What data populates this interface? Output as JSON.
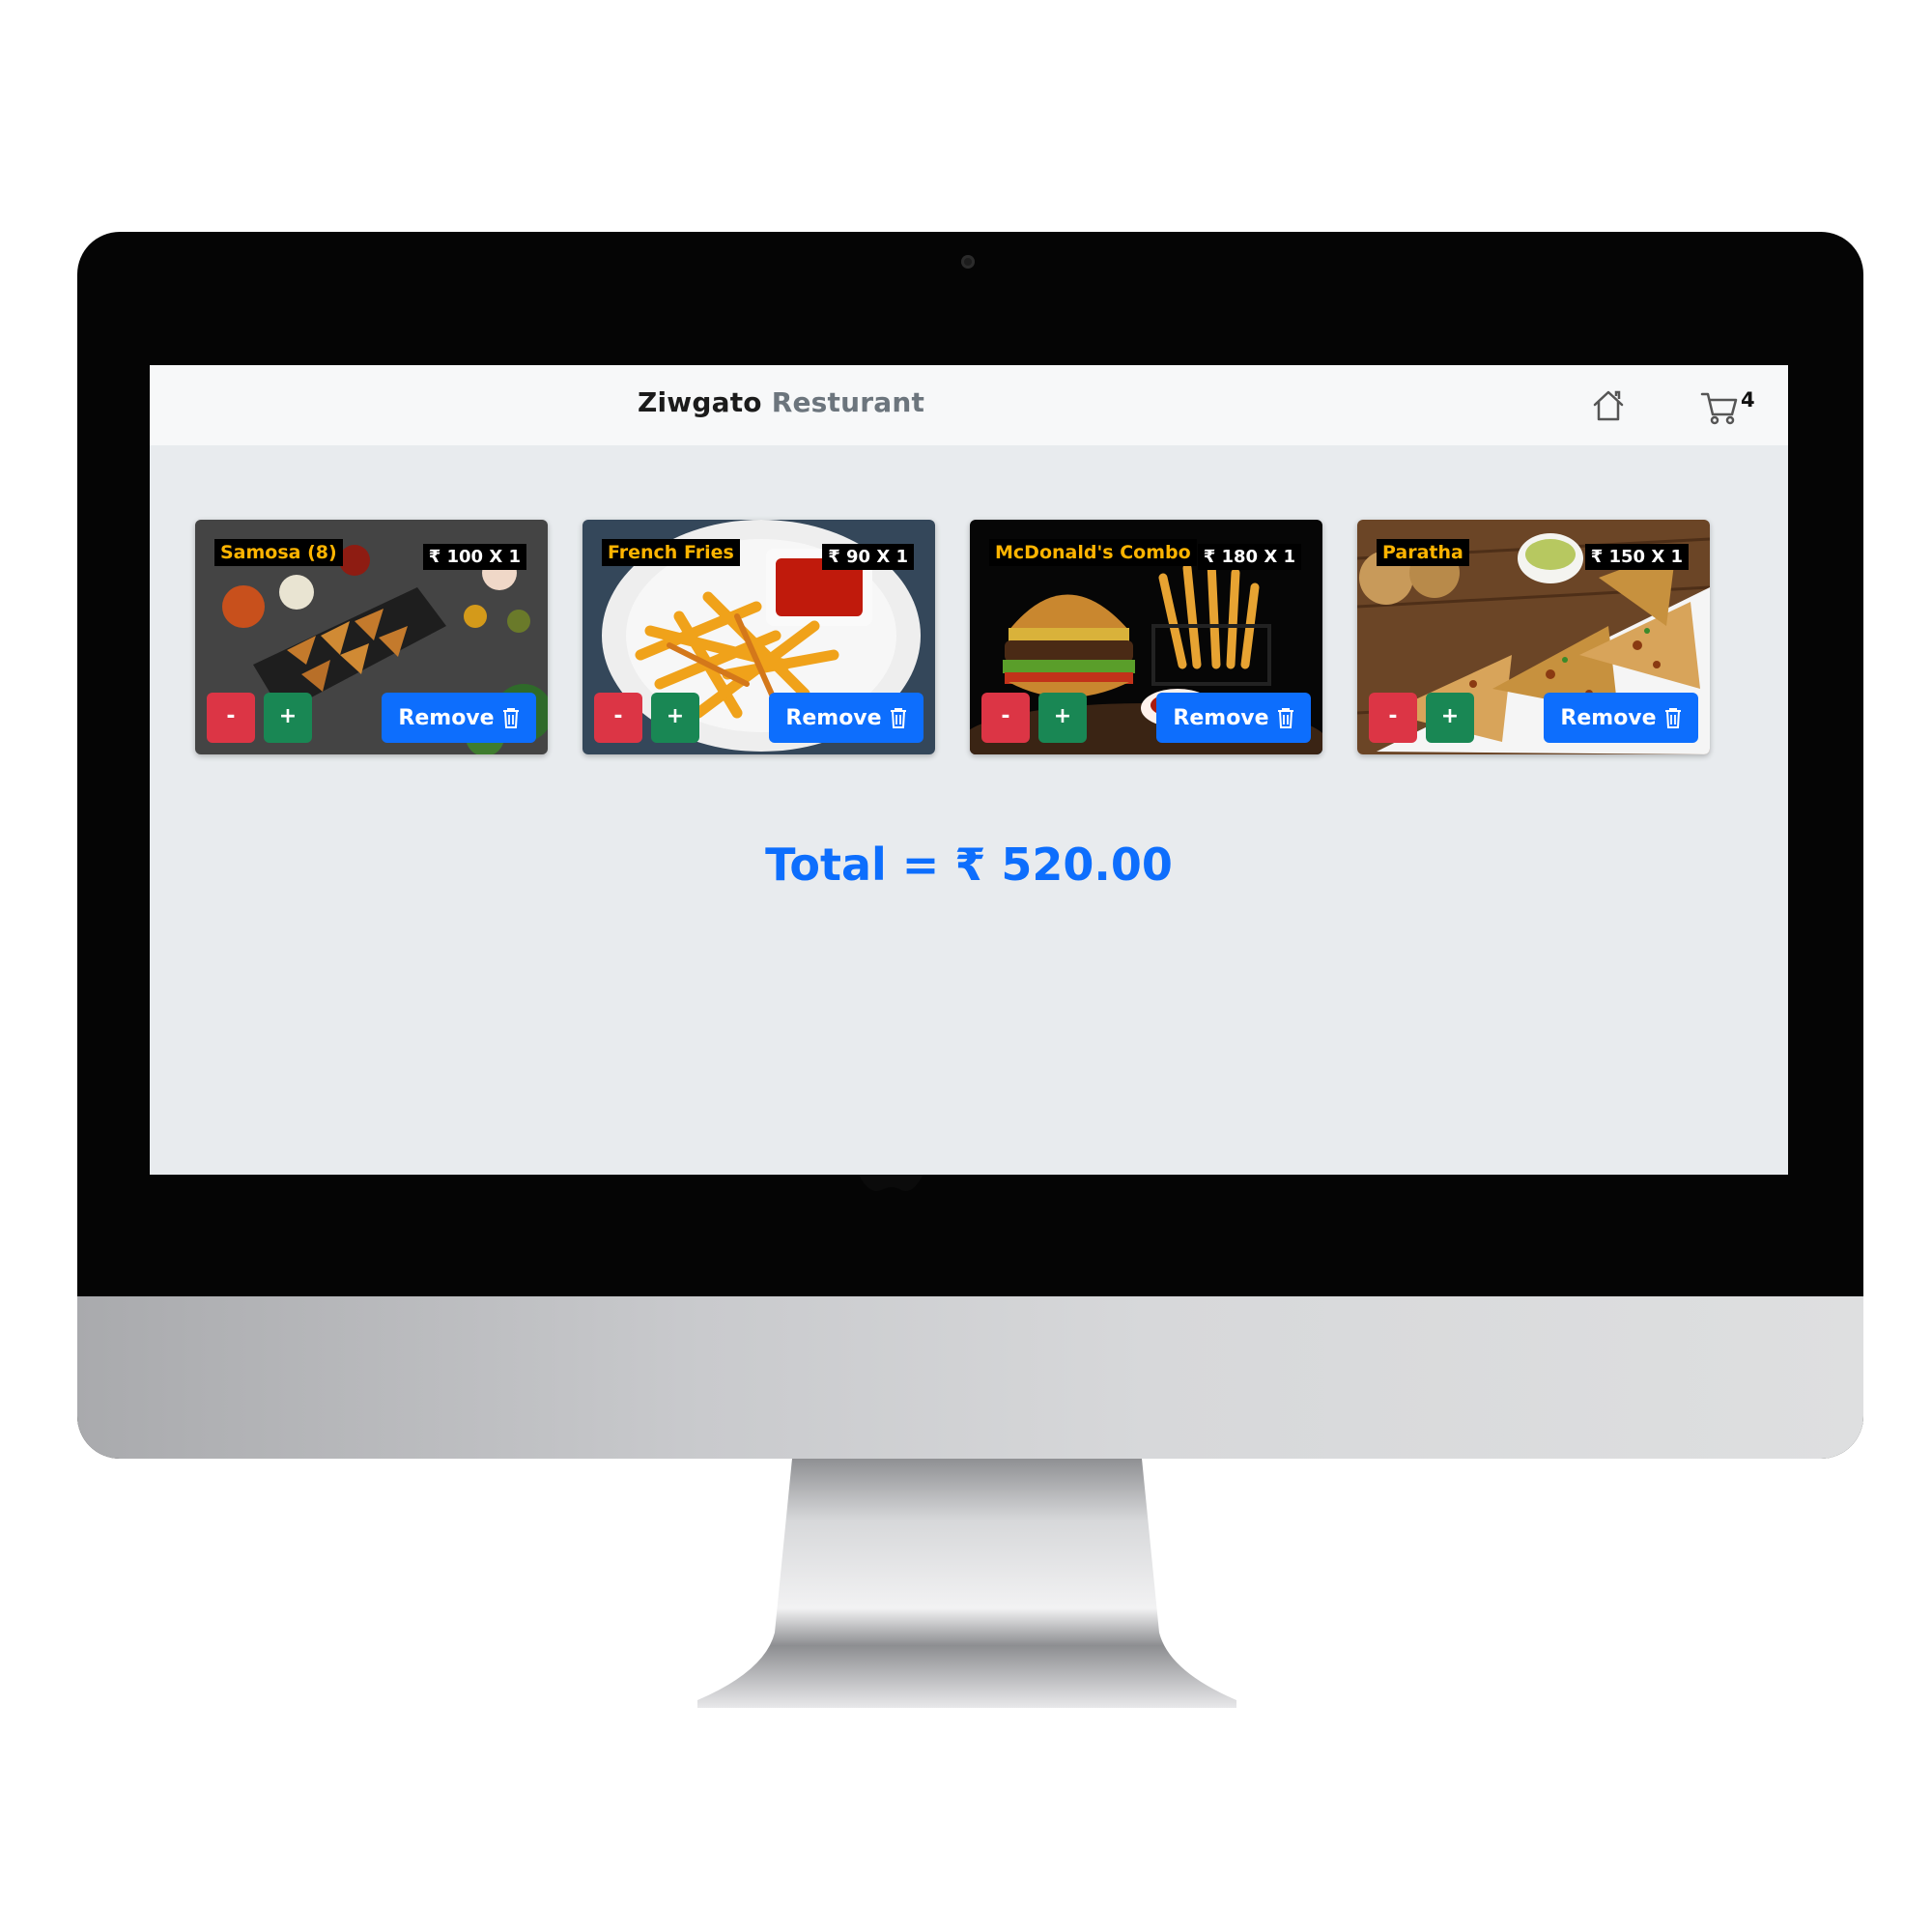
{
  "navbar": {
    "brand_main": "Ziwgato",
    "brand_sub": "Resturant",
    "cart_count": "4"
  },
  "cart": {
    "items": [
      {
        "name": "Samosa (8)",
        "price_label": "₹ 100 X 1",
        "minus": "-",
        "plus": "+",
        "remove": "Remove"
      },
      {
        "name": "French Fries",
        "price_label": "₹ 90 X 1",
        "minus": "-",
        "plus": "+",
        "remove": "Remove"
      },
      {
        "name": "McDonald's Combo",
        "price_label": "₹ 180 X 1",
        "minus": "-",
        "plus": "+",
        "remove": "Remove"
      },
      {
        "name": "Paratha",
        "price_label": "₹ 150 X 1",
        "minus": "-",
        "plus": "+",
        "remove": "Remove"
      }
    ],
    "total_label": "Total = ₹ 520.00"
  },
  "colors": {
    "accent": "#0d6efd",
    "danger": "#dc3545",
    "success": "#198754",
    "item_name": "#ffb400"
  },
  "icons": [
    "home-icon",
    "cart-icon",
    "trash-icon",
    "apple-logo-icon",
    "camera-icon"
  ]
}
